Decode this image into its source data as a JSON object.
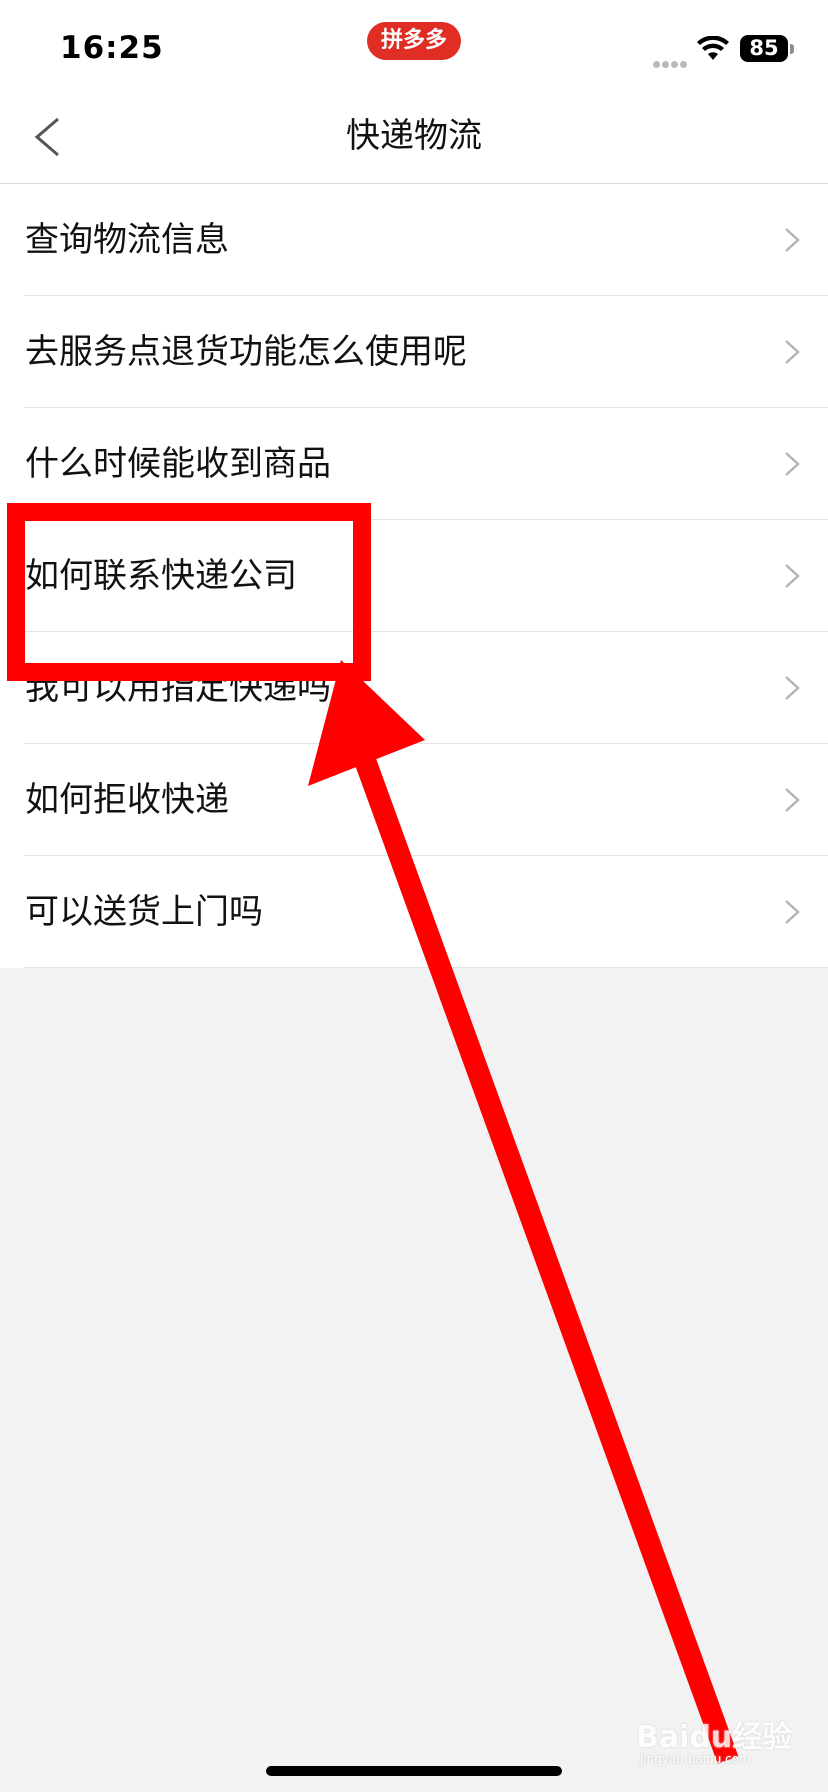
{
  "status_bar": {
    "time": "16:25",
    "app_badge": "拼多多",
    "battery": "85"
  },
  "nav": {
    "title": "快递物流",
    "back_icon": "chevron-left-icon"
  },
  "menu": {
    "items": [
      {
        "label": "查询物流信息"
      },
      {
        "label": "去服务点退货功能怎么使用呢"
      },
      {
        "label": "什么时候能收到商品"
      },
      {
        "label": "如何联系快递公司"
      },
      {
        "label": "我可以用指定快递吗"
      },
      {
        "label": "如何拒收快递"
      },
      {
        "label": "可以送货上门吗"
      }
    ],
    "item_icon": "chevron-right-icon"
  },
  "annotation": {
    "highlighted_item": "如何联系快递公司",
    "color": "#ff0000"
  },
  "watermark": {
    "text": "Baidu经验",
    "subtext": "jingyan.baidu.com"
  },
  "colors": {
    "brand_red": "#e02e24",
    "background": "#f3f2f3",
    "surface": "#ffffff",
    "divider": "#e2e2e2",
    "chevron": "#b5b5b5"
  }
}
